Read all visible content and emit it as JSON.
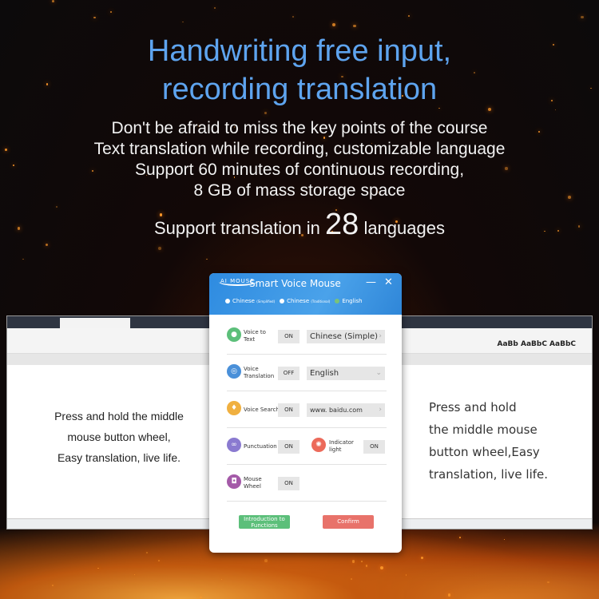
{
  "headline": {
    "line1": "Handwriting free input,",
    "line2": "recording translation"
  },
  "subtitle": [
    "Don't be afraid to miss the key points of the course",
    "Text translation while recording, customizable language",
    "Support 60 minutes of continuous recording,",
    "8 GB of mass storage space"
  ],
  "languages": {
    "prefix": "Support translation in",
    "count": "28",
    "suffix": "languages"
  },
  "doc_left_text": [
    "Press and hold the middle",
    "mouse button wheel,",
    "Easy translation, live life."
  ],
  "doc_right_text": [
    "Press and hold",
    "the middle mouse",
    "button wheel,Easy",
    "translation, live life."
  ],
  "doc_ribbon_right": "AaBb AaBbC AaBbC",
  "dialog": {
    "logo": "AI MOUSE",
    "title": "Smart Voice Mouse",
    "minimize": "—",
    "close": "✕",
    "ui_languages": [
      {
        "label": "Chinese",
        "note": "(Simplified)",
        "selected": false
      },
      {
        "label": "Chinese",
        "note": "(Traditional)",
        "selected": false
      },
      {
        "label": "English",
        "note": "",
        "selected": true
      }
    ],
    "rows": {
      "voice_to_text": {
        "label1": "Voice to",
        "label2": "Text",
        "state": "ON",
        "value": "Chinese (Simple)",
        "icon": "microphone-icon",
        "color": "#5cbf7a"
      },
      "voice_translation": {
        "label1": "Voice",
        "label2": "Translation",
        "state": "OFF",
        "value": "English",
        "icon": "translate-icon",
        "color": "#4a90d9"
      },
      "voice_search": {
        "label1": "Voice Search",
        "state": "ON",
        "value": "www. baidu.com",
        "icon": "lightbulb-icon",
        "color": "#f0b040"
      },
      "punctuation": {
        "label1": "Punctuation",
        "state": "ON",
        "icon": "punctuation-icon",
        "color": "#8a7ad0"
      },
      "indicator_light": {
        "label1": "Indicator",
        "label2": "light",
        "state": "ON",
        "icon": "light-icon",
        "color": "#ec6a5a"
      },
      "mouse_wheel": {
        "label1": "Mouse",
        "label2": "Wheel",
        "state": "ON",
        "icon": "mouse-icon",
        "color": "#a45aa8"
      }
    },
    "intro_button": {
      "line1": "Introduction to",
      "line2": "Functions",
      "color": "#5cbf7a"
    },
    "confirm_button": {
      "label": "Confirm",
      "color": "#e8726a"
    }
  },
  "colors": {
    "headline": "#5ea4ef",
    "dialog_header": "#2e8be0"
  }
}
